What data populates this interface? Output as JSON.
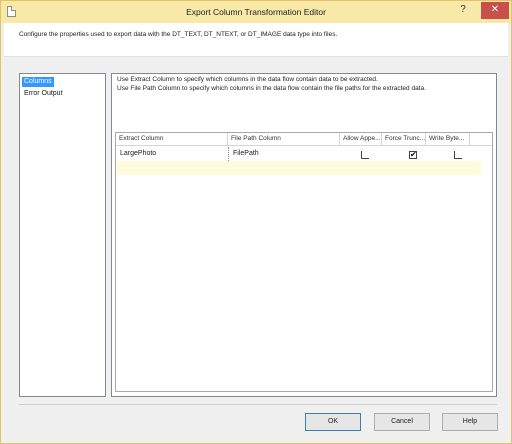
{
  "window": {
    "title": "Export Column Transformation Editor",
    "help_glyph": "?",
    "close_glyph": "✕"
  },
  "header": {
    "description": "Configure the properties used to export data with the DT_TEXT, DT_NTEXT, or DT_IMAGE data type into files."
  },
  "nav": {
    "items": [
      {
        "label": "Columns",
        "selected": true
      },
      {
        "label": "Error Output",
        "selected": false
      }
    ]
  },
  "panel": {
    "desc_line1": "Use Extract Column to specify which columns in the data flow contain data to be extracted.",
    "desc_line2": "Use File Path Column to specify which columns in the data flow contain the file paths for the extracted data."
  },
  "grid": {
    "columns": [
      "Extract Column",
      "File Path Column",
      "Allow Appe...",
      "Force Trunc...",
      "Write Byte..."
    ],
    "rows": [
      {
        "extract": "LargePhoto",
        "file_path": "FilePath",
        "allow_append": false,
        "force_truncate": true,
        "write_bom": false
      }
    ],
    "check_glyph": "✔"
  },
  "buttons": {
    "ok": "OK",
    "cancel": "Cancel",
    "help": "Help"
  },
  "colors": {
    "title_bar": "#f8e9a9",
    "selection": "#3399ff",
    "new_row": "#fffbdf",
    "close_button": "#c7504b"
  }
}
